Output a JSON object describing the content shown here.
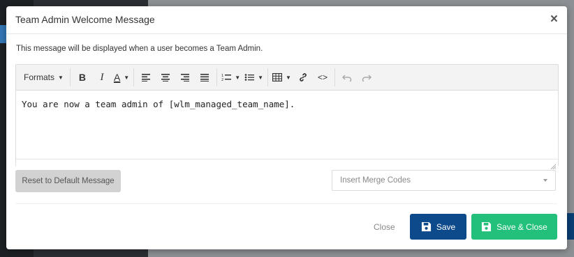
{
  "modal": {
    "title": "Team Admin Welcome Message",
    "description": "This message will be displayed when a user becomes a Team Admin."
  },
  "toolbar": {
    "formats_label": "Formats",
    "buttons": [
      "bold-icon",
      "italic-icon",
      "font-color-icon",
      "align-left-icon",
      "align-center-icon",
      "align-right-icon",
      "align-justify-icon",
      "numbered-list-icon",
      "bulleted-list-icon",
      "table-icon",
      "link-icon",
      "code-icon",
      "undo-icon",
      "redo-icon"
    ]
  },
  "editor": {
    "content": "You are now a team admin of [wlm_managed_team_name]."
  },
  "actions": {
    "reset_label": "Reset to Default Message",
    "merge_placeholder": "Insert Merge Codes",
    "close_label": "Close",
    "save_label": "Save",
    "save_close_label": "Save & Close"
  },
  "colors": {
    "save": "#0d4a8b",
    "save_close": "#22c07a",
    "reset": "#d2d2d2"
  }
}
